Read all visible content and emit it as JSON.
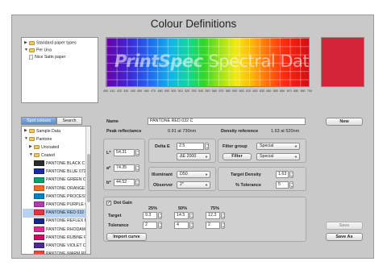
{
  "window": {
    "title": "Colour Definitions"
  },
  "paper_tree": {
    "items": [
      {
        "label": "Standard paper types",
        "expanded": false,
        "icon": "folder-icon"
      },
      {
        "label": "Per Una",
        "expanded": true,
        "icon": "folder-icon"
      },
      {
        "label": "Nice Satin paper",
        "icon": "document-icon"
      }
    ]
  },
  "spectrum": {
    "watermark_bold": "PrintSpec",
    "watermark_light": "Spectral Data",
    "ticks": [
      "400",
      "410",
      "420",
      "430",
      "440",
      "450",
      "460",
      "470",
      "480",
      "490",
      "500",
      "510",
      "520",
      "530",
      "540",
      "550",
      "560",
      "570",
      "580",
      "590",
      "600",
      "610",
      "620",
      "630",
      "640",
      "650",
      "660",
      "670",
      "680",
      "690",
      "700"
    ]
  },
  "preview_color": "#d2253a",
  "tabs": {
    "spot_colours": "Spot colours",
    "search": "Search"
  },
  "library_tree": {
    "items": [
      {
        "label": "Sample Data",
        "expanded": false
      },
      {
        "label": "Pantone",
        "expanded": true
      },
      {
        "label": "Uncoated",
        "expanded": false
      },
      {
        "label": "Coated",
        "expanded": true
      }
    ],
    "colours": [
      {
        "label": "PANTONE BLACK C",
        "color": "#2b2b2b"
      },
      {
        "label": "PANTONE BLUE 072 C",
        "color": "#1c2aa3"
      },
      {
        "label": "PANTONE GREEN C",
        "color": "#00a56a"
      },
      {
        "label": "PANTONE ORANGE 021 C",
        "color": "#f36d21"
      },
      {
        "label": "PANTONE PROCESS BLUE C",
        "color": "#0083c4"
      },
      {
        "label": "PANTONE PURPLE C",
        "color": "#b43cb0"
      },
      {
        "label": "PANTONE RED 032 C",
        "color": "#e8343e",
        "selected": true
      },
      {
        "label": "PANTONE REFLEX BLUE C",
        "color": "#15288c"
      },
      {
        "label": "PANTONE RHODAMINE RED C",
        "color": "#e3298e"
      },
      {
        "label": "PANTONE RUBINE RED C",
        "color": "#cf0b64"
      },
      {
        "label": "PANTONE VIOLET C",
        "color": "#4e2a92"
      },
      {
        "label": "PANTONE WARM RED C",
        "color": "#f04a34"
      }
    ]
  },
  "form": {
    "name_label": "Name",
    "name_value": "PANTONE RED 032 C",
    "peak_label": "Peak reflectance",
    "peak_value": "0.91 at 730nm",
    "density_label": "Density reference",
    "density_value": "1.63 at 520nm",
    "L_label": "L*",
    "L_value": "54.31",
    "a_label": "a*",
    "a_value": "74.35",
    "b_label": "b*",
    "b_value": "44.52",
    "deltaE_label": "Delta E",
    "deltaE_value": "2.5",
    "deltaE_method": "ΔE 2000",
    "filter_group_label": "Filter group",
    "filter_group_value": "Special",
    "filter_button": "Filter",
    "filter_value": "Special",
    "illuminant_label": "Illuminant",
    "illuminant_value": "D50",
    "observer_label": "Observer",
    "observer_value": "2°",
    "target_density_label": "Target Density",
    "target_density_value": "1.63",
    "tolerance_pct_label": "% Tolerance",
    "tolerance_pct_value": "5",
    "dot_gain_label": "Dot Gain",
    "dot_gain_checked": "✓",
    "dot_cols": [
      "25%",
      "50%",
      "75%"
    ],
    "target_label": "Target",
    "target_values": [
      "9.3",
      "14.5",
      "12.3"
    ],
    "tolerance_label": "Tolerance",
    "tolerance_values": [
      "2",
      "4",
      "2"
    ],
    "import_curve": "Import curve"
  },
  "buttons": {
    "new": "New",
    "save": "Save",
    "save_as": "Save As"
  }
}
